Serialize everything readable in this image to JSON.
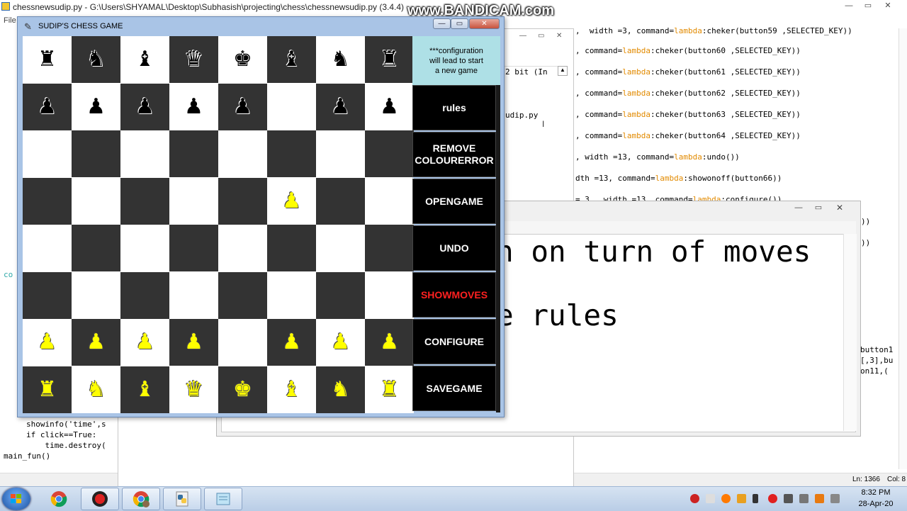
{
  "watermark": {
    "brand": "BANDICAM",
    "url": "www.BANDICAM.com"
  },
  "editor": {
    "title": "chessnewsudip.py - G:\\Users\\SHYAMAL\\Desktop\\Subhasish\\projecting\\chess\\chessnewsudip.py (3.4.4)",
    "menu_file": "File",
    "code_lines": [
      ", command=lambda:cheker(button60 ,SELECTED_KEY))",
      ", command=lambda:cheker(button61 ,SELECTED_KEY))",
      ", command=lambda:cheker(button62 ,SELECTED_KEY))",
      ", command=lambda:cheker(button63 ,SELECTED_KEY))",
      ", command=lambda:cheker(button64 ,SELECTED_KEY))",
      ", width =13, command=lambda:undo())",
      "dth =13, command=lambda:showonoff(button66))",
      "= 3,  width =13, command=lambda:configure())"
    ],
    "code_top_partial": ",  width =3, command=lambda:cheker(button59 ,SELECTED_KEY))",
    "left_snippet": [
      "showinfo('time',s",
      "if click==True:",
      "    time.destroy(",
      "main_fun()"
    ],
    "left_co": "co",
    "right_fragments": [
      "))",
      "))",
      "button1",
      "[,3],bu",
      "on11,("
    ],
    "status": {
      "ln": "Ln: 1366",
      "col": "Col: 8"
    }
  },
  "shell": {
    "version_frag": "2 bit (In",
    "path_frag": "udip.py"
  },
  "rules_window": {
    "line1": "n on turn of moves",
    "line2": "e rules"
  },
  "chess": {
    "title": "SUDIP'S CHESS GAME",
    "window_controls": {
      "minimize": "—",
      "maximize": "▭",
      "close": "✕"
    },
    "board": [
      [
        "bR",
        "bN",
        "bB",
        "bQ",
        "bK",
        "bB",
        "bN",
        "bR"
      ],
      [
        "bP",
        "bP",
        "bP",
        "bP",
        "bP",
        "",
        "bP",
        "bP"
      ],
      [
        "",
        "",
        "",
        "",
        "",
        "",
        "",
        ""
      ],
      [
        "",
        "",
        "",
        "",
        "",
        "yP",
        "",
        ""
      ],
      [
        "",
        "",
        "",
        "",
        "",
        "",
        "",
        ""
      ],
      [
        "",
        "",
        "",
        "",
        "",
        "",
        "",
        ""
      ],
      [
        "yP",
        "yP",
        "yP",
        "yP",
        "",
        "yP",
        "yP",
        "yP"
      ],
      [
        "yR",
        "yN",
        "yB",
        "yQ",
        "yK",
        "yB",
        "yN",
        "yR"
      ]
    ],
    "glyphs": {
      "R": "♜",
      "N": "♞",
      "B": "♝",
      "Q": "♛",
      "K": "♚",
      "P": "♟"
    },
    "config_note": "***configuration\nwill lead to start\na new game",
    "buttons": [
      {
        "label": "rules",
        "color": "#ffffff"
      },
      {
        "label": "REMOVE\nCOLOURERROR",
        "color": "#ffffff"
      },
      {
        "label": "OPENGAME",
        "color": "#ffffff"
      },
      {
        "label": "UNDO",
        "color": "#ffffff"
      },
      {
        "label": "SHOWMOVES",
        "color": "#ff2020"
      },
      {
        "label": "CONFIGURE",
        "color": "#ffffff"
      },
      {
        "label": "SAVEGAME",
        "color": "#ffffff"
      }
    ]
  },
  "taskbar": {
    "apps": [
      "chrome-icon",
      "bandicam-icon",
      "chrome-profile-icon",
      "python-idle-icon",
      "notepad-icon"
    ],
    "clock": {
      "time": "8:32 PM",
      "date": "28-Apr-20"
    }
  }
}
